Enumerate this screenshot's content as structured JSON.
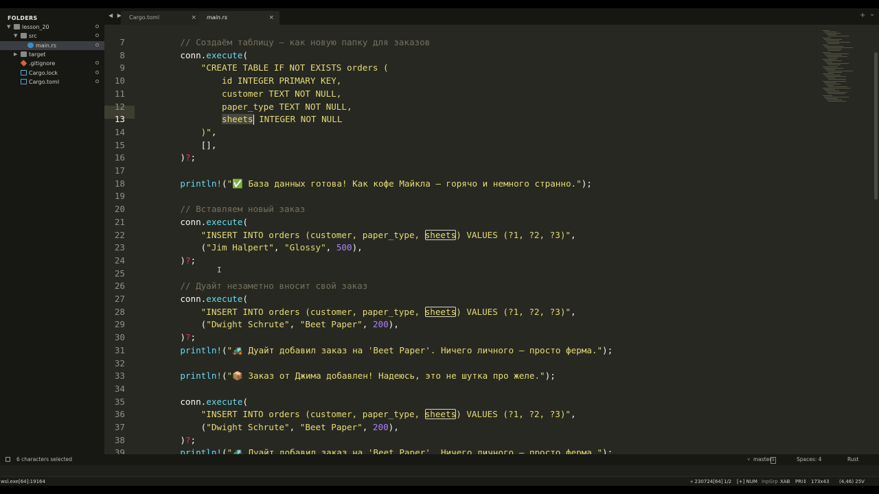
{
  "sidebar": {
    "title": "FOLDERS",
    "items": [
      {
        "label": "lesson_20",
        "arrow": "▼",
        "type": "folder",
        "indent": 0
      },
      {
        "label": "src",
        "arrow": "▼",
        "type": "folder",
        "indent": 1
      },
      {
        "label": "main.rs",
        "arrow": "",
        "type": "rust",
        "indent": 2,
        "selected": true
      },
      {
        "label": "target",
        "arrow": "▶",
        "type": "folder",
        "indent": 1
      },
      {
        "label": ".gitignore",
        "arrow": "",
        "type": "git",
        "indent": 1
      },
      {
        "label": "Cargo.lock",
        "arrow": "",
        "type": "tag",
        "indent": 1
      },
      {
        "label": "Cargo.toml",
        "arrow": "",
        "type": "tag",
        "indent": 1
      }
    ]
  },
  "tabs": {
    "nav": "◀ ▶",
    "items": [
      {
        "label": "Cargo.toml",
        "close": "×",
        "active": false
      },
      {
        "label": "main.rs",
        "close": "×",
        "active": true
      }
    ],
    "add": "+",
    "dropdown": "⌄"
  },
  "editor": {
    "current_line": 13,
    "lines": [
      {
        "n": "7",
        "parts": [
          [
            "c-com",
            "    // Создаём таблицу — как новую папку для заказов"
          ]
        ]
      },
      {
        "n": "8",
        "parts": [
          [
            "c-txt",
            "    conn."
          ],
          [
            "c-fn",
            "execute"
          ],
          [
            "c-txt",
            "("
          ]
        ]
      },
      {
        "n": "9",
        "parts": [
          [
            "c-str",
            "        \"CREATE TABLE IF NOT EXISTS orders ("
          ]
        ]
      },
      {
        "n": "10",
        "parts": [
          [
            "c-str",
            "            id INTEGER PRIMARY KEY,"
          ]
        ]
      },
      {
        "n": "11",
        "parts": [
          [
            "c-str",
            "            customer TEXT NOT NULL,"
          ]
        ]
      },
      {
        "n": "12",
        "parts": [
          [
            "c-str",
            "            paper_type TEXT NOT NULL,"
          ]
        ]
      },
      {
        "n": "13",
        "parts": [
          [
            "c-str",
            "            "
          ],
          [
            "c-str hl-sel",
            "sheets"
          ],
          [
            "caret",
            ""
          ],
          [
            "c-str",
            " INTEGER NOT NULL"
          ]
        ]
      },
      {
        "n": "14",
        "parts": [
          [
            "c-str",
            "        )\""
          ],
          [
            "c-txt",
            ","
          ]
        ]
      },
      {
        "n": "15",
        "parts": [
          [
            "c-txt",
            "        [],"
          ]
        ]
      },
      {
        "n": "16",
        "parts": [
          [
            "c-txt",
            "    )"
          ],
          [
            "c-err",
            "?"
          ],
          [
            "c-txt",
            ";"
          ]
        ]
      },
      {
        "n": "17",
        "parts": []
      },
      {
        "n": "18",
        "parts": [
          [
            "c-fn",
            "    println!"
          ],
          [
            "c-txt",
            "("
          ],
          [
            "c-str",
            "\"✅ База данных готова! Как кофе Майкла — горячо и немного странно.\""
          ],
          [
            "c-txt",
            ");"
          ]
        ]
      },
      {
        "n": "19",
        "parts": []
      },
      {
        "n": "20",
        "parts": [
          [
            "c-com",
            "    // Вставляем новый заказ"
          ]
        ]
      },
      {
        "n": "21",
        "parts": [
          [
            "c-txt",
            "    conn."
          ],
          [
            "c-fn",
            "execute"
          ],
          [
            "c-txt",
            "("
          ]
        ]
      },
      {
        "n": "22",
        "parts": [
          [
            "c-str",
            "        \"INSERT INTO orders (customer, paper_type, "
          ],
          [
            "c-str hl-box",
            "sheets"
          ],
          [
            "c-str",
            ") VALUES (?1, ?2, ?3)\""
          ],
          [
            "c-txt",
            ","
          ]
        ]
      },
      {
        "n": "23",
        "parts": [
          [
            "c-txt",
            "        ("
          ],
          [
            "c-str",
            "\"Jim Halpert\""
          ],
          [
            "c-txt",
            ", "
          ],
          [
            "c-str",
            "\"Glossy\""
          ],
          [
            "c-txt",
            ", "
          ],
          [
            "c-num",
            "500"
          ],
          [
            "c-txt",
            "),"
          ]
        ]
      },
      {
        "n": "24",
        "parts": [
          [
            "c-txt",
            "    )"
          ],
          [
            "c-err",
            "?"
          ],
          [
            "c-txt",
            ";"
          ]
        ]
      },
      {
        "n": "25",
        "parts": []
      },
      {
        "n": "26",
        "parts": [
          [
            "c-com",
            "    // Дуайт незаметно вносит свой заказ"
          ]
        ]
      },
      {
        "n": "27",
        "parts": [
          [
            "c-txt",
            "    conn."
          ],
          [
            "c-fn",
            "execute"
          ],
          [
            "c-txt",
            "("
          ]
        ]
      },
      {
        "n": "28",
        "parts": [
          [
            "c-str",
            "        \"INSERT INTO orders (customer, paper_type, "
          ],
          [
            "c-str hl-box",
            "sheets"
          ],
          [
            "c-str",
            ") VALUES (?1, ?2, ?3)\""
          ],
          [
            "c-txt",
            ","
          ]
        ]
      },
      {
        "n": "29",
        "parts": [
          [
            "c-txt",
            "        ("
          ],
          [
            "c-str",
            "\"Dwight Schrute\""
          ],
          [
            "c-txt",
            ", "
          ],
          [
            "c-str",
            "\"Beet Paper\""
          ],
          [
            "c-txt",
            ", "
          ],
          [
            "c-num",
            "200"
          ],
          [
            "c-txt",
            "),"
          ]
        ]
      },
      {
        "n": "30",
        "parts": [
          [
            "c-txt",
            "    )"
          ],
          [
            "c-err",
            "?"
          ],
          [
            "c-txt",
            ";"
          ]
        ]
      },
      {
        "n": "31",
        "parts": [
          [
            "c-fn",
            "    println!"
          ],
          [
            "c-txt",
            "("
          ],
          [
            "c-str",
            "\"🚜 Дуайт добавил заказ на 'Beet Paper'. Ничего личного — просто ферма.\""
          ],
          [
            "c-txt",
            ");"
          ]
        ]
      },
      {
        "n": "32",
        "parts": []
      },
      {
        "n": "33",
        "parts": [
          [
            "c-fn",
            "    println!"
          ],
          [
            "c-txt",
            "("
          ],
          [
            "c-str",
            "\"📦 Заказ от Джима добавлен! Надеюсь, это не шутка про желе.\""
          ],
          [
            "c-txt",
            ");"
          ]
        ]
      },
      {
        "n": "34",
        "parts": []
      },
      {
        "n": "35",
        "parts": [
          [
            "c-txt",
            "    conn."
          ],
          [
            "c-fn",
            "execute"
          ],
          [
            "c-txt",
            "("
          ]
        ]
      },
      {
        "n": "36",
        "parts": [
          [
            "c-str",
            "        \"INSERT INTO orders (customer, paper_type, "
          ],
          [
            "c-str hl-box",
            "sheets"
          ],
          [
            "c-str",
            ") VALUES (?1, ?2, ?3)\""
          ],
          [
            "c-txt",
            ","
          ]
        ]
      },
      {
        "n": "37",
        "parts": [
          [
            "c-txt",
            "        ("
          ],
          [
            "c-str",
            "\"Dwight Schrute\""
          ],
          [
            "c-txt",
            ", "
          ],
          [
            "c-str",
            "\"Beet Paper\""
          ],
          [
            "c-txt",
            ", "
          ],
          [
            "c-num",
            "200"
          ],
          [
            "c-txt",
            "),"
          ]
        ]
      },
      {
        "n": "38",
        "parts": [
          [
            "c-txt",
            "    )"
          ],
          [
            "c-err",
            "?"
          ],
          [
            "c-txt",
            ";"
          ]
        ]
      },
      {
        "n": "39",
        "parts": [
          [
            "c-fn",
            "    println!"
          ],
          [
            "c-txt",
            "("
          ],
          [
            "c-str",
            "\"🚜 Дуайт добавил заказ на 'Beet Paper'. Ничего личного — просто ферма.\""
          ],
          [
            "c-txt",
            ");"
          ]
        ]
      }
    ]
  },
  "status": {
    "selection": "6 characters selected",
    "branch": "master",
    "branch_badge": "5",
    "spaces": "Spaces: 4",
    "syntax": "Rust"
  },
  "terminal": {
    "left": "wsl.exe[64]:19164",
    "pos": "« 230724[64]",
    "pages": "1/2",
    "flags": "[+] NUM",
    "inpgrp": "InpGrp",
    "xab": "XAB",
    "pri": "PRI↕",
    "size": "173x43",
    "coords": "(4,46) 25V"
  },
  "colors": {
    "background": "#272822",
    "comment": "#75715e",
    "string": "#e6db74",
    "function": "#66d9ef",
    "number": "#ae81ff",
    "error": "#f92672"
  }
}
